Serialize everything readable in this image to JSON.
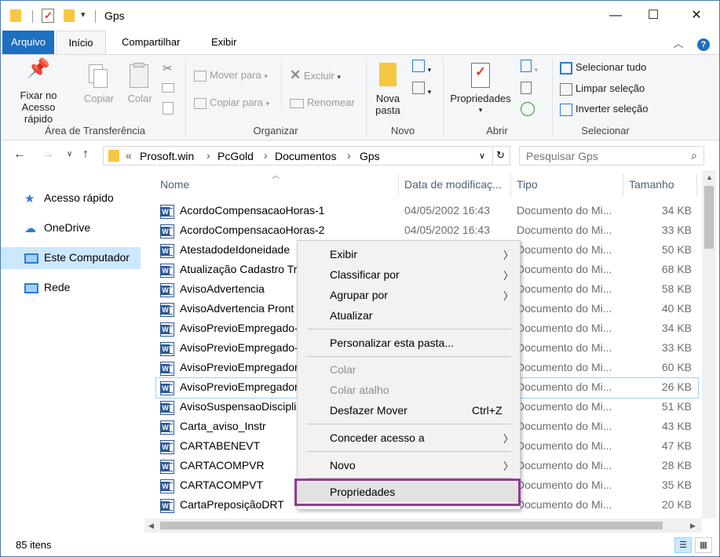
{
  "window": {
    "title": "Gps",
    "controls": {
      "minimize": "—",
      "maximize": "☐",
      "close": "✕"
    }
  },
  "ribbon_tabs": {
    "file": "Arquivo",
    "home": "Início",
    "share": "Compartilhar",
    "view": "Exibir"
  },
  "ribbon": {
    "clipboard": {
      "label": "Área de Transferência",
      "pin": "Fixar no",
      "pin2": "Acesso rápido",
      "copy": "Copiar",
      "paste": "Colar"
    },
    "organize": {
      "label": "Organizar",
      "move_to": "Mover para",
      "copy_to": "Copiar para",
      "delete": "Excluir",
      "rename": "Renomear"
    },
    "new": {
      "label": "Novo",
      "new_folder": "Nova",
      "new_folder2": "pasta"
    },
    "open": {
      "label": "Abrir",
      "properties": "Propriedades"
    },
    "select": {
      "label": "Selecionar",
      "select_all": "Selecionar tudo",
      "select_none": "Limpar seleção",
      "invert": "Inverter seleção"
    }
  },
  "address": {
    "prefix": "«",
    "crumbs": [
      "Prosoft.win",
      "PcGold",
      "Documentos",
      "Gps"
    ],
    "search_placeholder": "Pesquisar Gps"
  },
  "sidebar": {
    "items": [
      {
        "label": "Acesso rápido",
        "icon": "star-icon"
      },
      {
        "label": "OneDrive",
        "icon": "cloud-icon"
      },
      {
        "label": "Este Computador",
        "icon": "computer-icon"
      },
      {
        "label": "Rede",
        "icon": "network-icon"
      }
    ]
  },
  "columns": {
    "name": "Nome",
    "date": "Data de modificaç...",
    "type": "Tipo",
    "size": "Tamanho"
  },
  "files": [
    {
      "name": "AcordoCompensacaoHoras-1",
      "date": "04/05/2002 16:43",
      "type": "Documento do Mi...",
      "size": "34 KB"
    },
    {
      "name": "AcordoCompensacaoHoras-2",
      "date": "04/05/2002 16:43",
      "type": "Documento do Mi...",
      "size": "33 KB"
    },
    {
      "name": "AtestadodeIdoneidade",
      "date": "",
      "type": "Documento do Mi...",
      "size": "50 KB"
    },
    {
      "name": "Atualização Cadastro Tr",
      "date": "",
      "type": "Documento do Mi...",
      "size": "68 KB"
    },
    {
      "name": "AvisoAdvertencia",
      "date": "",
      "type": "Documento do Mi...",
      "size": "58 KB"
    },
    {
      "name": "AvisoAdvertencia Pront",
      "date": "",
      "type": "Documento do Mi...",
      "size": "40 KB"
    },
    {
      "name": "AvisoPrevioEmpregado-",
      "date": "",
      "type": "Documento do Mi...",
      "size": "34 KB"
    },
    {
      "name": "AvisoPrevioEmpregado-",
      "date": "",
      "type": "Documento do Mi...",
      "size": "33 KB"
    },
    {
      "name": "AvisoPrevioEmpregador",
      "date": "",
      "type": "Documento do Mi...",
      "size": "60 KB"
    },
    {
      "name": "AvisoPrevioEmpregador",
      "date": "",
      "type": "Documento do Mi...",
      "size": "26 KB"
    },
    {
      "name": "AvisoSuspensaoDiscipli",
      "date": "",
      "type": "Documento do Mi...",
      "size": "51 KB"
    },
    {
      "name": "Carta_aviso_Instr",
      "date": "",
      "type": "Documento do Mi...",
      "size": "43 KB"
    },
    {
      "name": "CARTABENEVT",
      "date": "",
      "type": "Documento do Mi...",
      "size": "47 KB"
    },
    {
      "name": "CARTACOMPVR",
      "date": "",
      "type": "Documento do Mi...",
      "size": "28 KB"
    },
    {
      "name": "CARTACOMPVT",
      "date": "",
      "type": "Documento do Mi...",
      "size": "35 KB"
    },
    {
      "name": "CartaPreposiçãoDRT",
      "date": "",
      "type": "Documento do Mi...",
      "size": "20 KB"
    }
  ],
  "context_menu": {
    "view": "Exibir",
    "sort_by": "Classificar por",
    "group_by": "Agrupar por",
    "refresh": "Atualizar",
    "customize": "Personalizar esta pasta...",
    "paste": "Colar",
    "paste_shortcut": "Colar atalho",
    "undo": "Desfazer Mover",
    "undo_key": "Ctrl+Z",
    "grant_access": "Conceder acesso a",
    "new": "Novo",
    "properties": "Propriedades"
  },
  "status": {
    "count": "85 itens"
  },
  "colors": {
    "accent": "#1d6fc0",
    "highlight_box": "#8e3f8d",
    "selection": "#cce8ff"
  }
}
